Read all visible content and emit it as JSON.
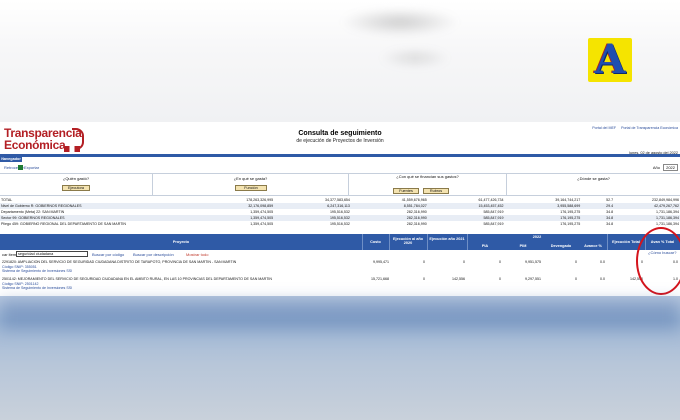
{
  "brand": {
    "line1": "Transparencia",
    "line2": "Económica"
  },
  "logo_letter": "A",
  "header": {
    "title": "Consulta de seguimiento",
    "subtitle": "de ejecución de Proyectos de Inversión"
  },
  "top_links": [
    "Portal del MEF",
    "Portal de Transparencia Económica"
  ],
  "date": "lunes, 02 de agosto del 2022",
  "nav_tab": "Navegador",
  "toolbar": {
    "back": "Retroceder",
    "export": "Exportar",
    "year_label": "Año",
    "year_value": "2022"
  },
  "questions": [
    {
      "text": "¿Quién gastó?",
      "button": "Ejecutora"
    },
    {
      "text": "¿En qué se gasta?",
      "button": "Función"
    },
    {
      "text": "¿Con qué se financian sus gastos?",
      "buttons": [
        "Fuentes",
        "Rubros"
      ]
    },
    {
      "text": "¿Dónde se gasta?"
    }
  ],
  "summary_rows": [
    {
      "label": "TOTAL",
      "c1": "178,263,326,995",
      "c2": "34,377,583,654",
      "c3": "41,559,676,965",
      "c4": "61,477,426,734",
      "c5": "39,164,744,217",
      "c6": "52.7",
      "c7": "232,849,984,996"
    },
    {
      "label": "Nivel de Gobierno R: GOBIERNOS REGIONALES",
      "c1": "32,176,098,859",
      "c2": "6,247,316,113",
      "c3": "8,551,784,027",
      "c4": "15,453,457,452",
      "c5": "3,955,588,699",
      "c6": "29.4",
      "c7": "42,479,267,762"
    },
    {
      "label": "Departamento (Meta) 22: SAN MARTIN",
      "c1": "1,359,474,505",
      "c2": "195,516,532",
      "c3": "282,316,990",
      "c4": "585,847,919",
      "c5": "176,195,275",
      "c6": "34.8",
      "c7": "1,731,186,394"
    },
    {
      "label": "Sector 99: GOBIERNOS REGIONALES",
      "c1": "1,359,474,505",
      "c2": "195,516,532",
      "c3": "282,316,990",
      "c4": "585,847,919",
      "c5": "176,195,275",
      "c6": "34.8",
      "c7": "1,731,186,394"
    },
    {
      "label": "Pliego 459: GOBIERNO REGIONAL DEL DEPARTAMENTO DE SAN MARTIN",
      "c1": "1,359,474,505",
      "c2": "195,516,532",
      "c3": "282,316,990",
      "c4": "585,847,919",
      "c5": "176,195,275",
      "c6": "34.8",
      "c7": "1,731,186,394"
    }
  ],
  "project_header": {
    "proyecto": "Proyecto",
    "costo": "Costo",
    "ejec_ant": "Ejecución al año 2020",
    "ejec_2021": "Ejecución año 2021",
    "year": "2022",
    "pia": "PIA",
    "pim": "PIM",
    "devengado": "Devengado",
    "avance": "Avance %",
    "ejec_total": "Ejecución Total",
    "avance_total": "Avan % Total"
  },
  "search": {
    "label": "car item",
    "value": "seguridad ciudadana",
    "by_code": "Buscar por código",
    "by_desc": "Buscar por descripción",
    "show_all": "Mostrar todo"
  },
  "projects": [
    {
      "title": "2291820: AMPLIACION DEL SERVICIO DE SEGURIDAD CIUDADANA DISTRITO DE TARAPOTO, PROVINCIA DE SAN MARTIN - SAN MARTIN",
      "costo": "9,995,471",
      "ejec_ant": "0",
      "ejec_2021": "0",
      "pia": "0",
      "pim": "9,951,575",
      "dev": "0",
      "avance": "0.0",
      "ejec_total": "0",
      "avance_total": "0.0",
      "code": "Código SNIP: 355051",
      "system": "Sistema de Seguimiento de Inversiones SSI"
    },
    {
      "title": "2501142: MEJORAMIENTO DEL SERVICIO DE SEGURIDAD CIUDADANA EN EL AMBITO RURAL, EN LAS 10 PROVINCIAS DEL DEPARTAMENTO DE SAN MARTIN",
      "costo": "15,721,668",
      "ejec_ant": "0",
      "ejec_2021": "142,556",
      "pia": "0",
      "pim": "9,297,551",
      "dev": "0",
      "avance": "0.0",
      "ejec_total": "142,556",
      "avance_total": "1.0",
      "code": "Código SNIP: 2501142",
      "system": "Sistema de Seguimiento de Inversiones SSI"
    }
  ],
  "buscar_link": "¿Cómo buscar?",
  "colors": {
    "brand_red": "#b31f24",
    "header_blue": "#2f5aa6",
    "highlight_red": "#d4141c",
    "logo_yellow": "#f5e400"
  }
}
